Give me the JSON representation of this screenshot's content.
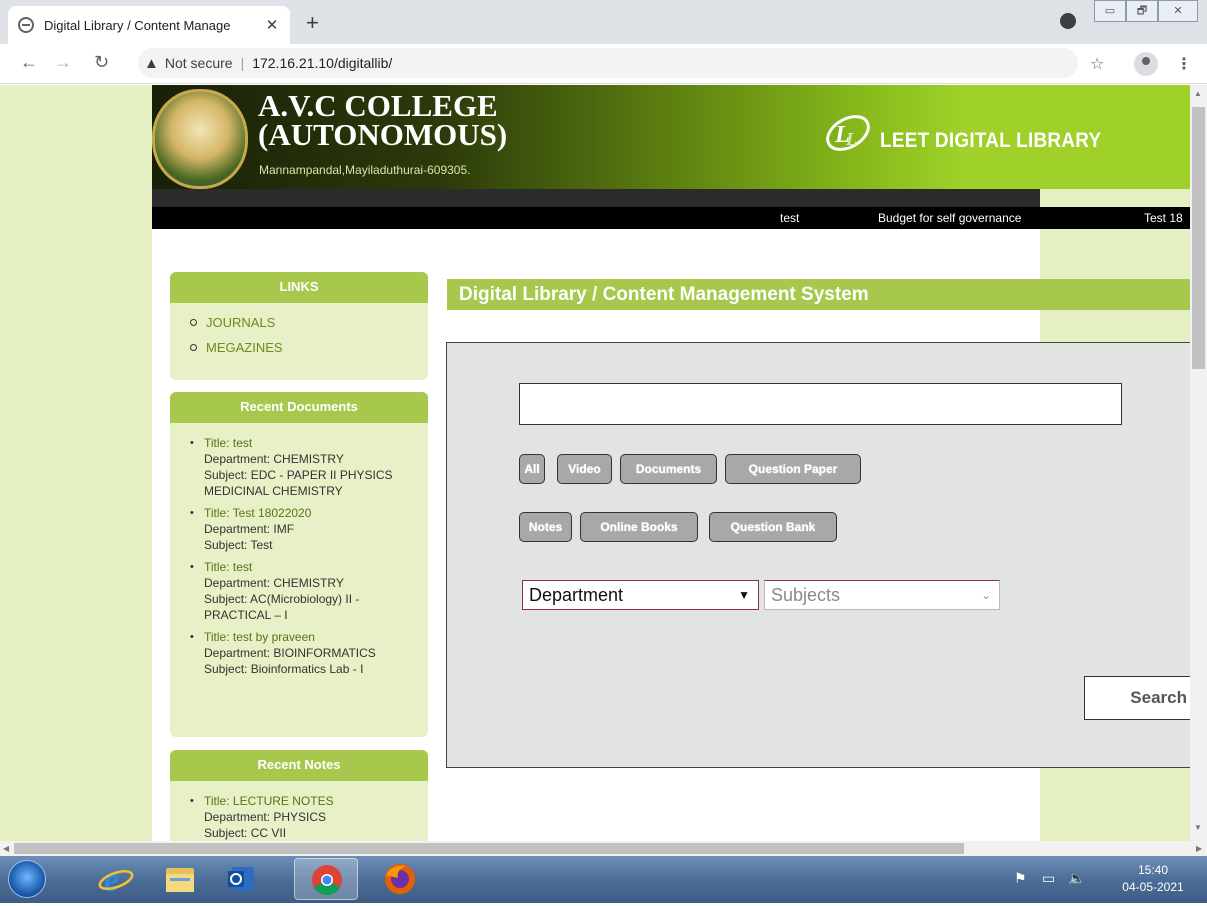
{
  "browser": {
    "tab_title": "Digital Library / Content Manage",
    "tab_close": "✕",
    "new_tab": "+",
    "not_secure": "Not secure",
    "url": "172.16.21.10/digitallib/",
    "window_min": "▭",
    "window_max": "🗗",
    "window_close": "✕"
  },
  "header": {
    "college_line1": "A.V.C COLLEGE",
    "college_line2": "(AUTONOMOUS)",
    "address": "Mannampandal,Mayiladuthurai-609305.",
    "library_name": "LEET DIGITAL LIBRARY",
    "ticker": [
      "test",
      "Budget for self governance",
      "Test 18"
    ]
  },
  "sidebar": {
    "links": {
      "heading": "LINKS",
      "items": [
        "JOURNALS",
        "MEGAZINES"
      ]
    },
    "recent_documents": {
      "heading": "Recent Documents",
      "items": [
        {
          "title": "Title: test",
          "department": "Department: CHEMISTRY",
          "subject": "Subject: EDC - PAPER II PHYSICS MEDICINAL CHEMISTRY"
        },
        {
          "title": "Title: Test 18022020",
          "department": "Department: IMF",
          "subject": "Subject: Test"
        },
        {
          "title": "Title: test",
          "department": "Department: CHEMISTRY",
          "subject": "Subject: AC(Microbiology) II - PRACTICAL – I"
        },
        {
          "title": "Title: test by praveen",
          "department": "Department: BIOINFORMATICS",
          "subject": "Subject: Bioinformatics Lab - I"
        }
      ]
    },
    "recent_notes": {
      "heading": "Recent Notes",
      "items": [
        {
          "title": "Title: LECTURE NOTES",
          "department": "Department: PHYSICS",
          "subject": "Subject: CC VII"
        }
      ]
    }
  },
  "main": {
    "heading": "Digital Library / Content Management System",
    "search_value": "",
    "filters_row1": [
      "All",
      "Video",
      "Documents",
      "Question Paper"
    ],
    "filters_row2": [
      "Notes",
      "Online Books",
      "Question Bank"
    ],
    "department_select": "Department",
    "subjects_select": "Subjects",
    "search_button": "Search"
  },
  "taskbar": {
    "time": "15:40",
    "date": "04-05-2021"
  },
  "colors": {
    "accent_green": "#a7c84d",
    "page_bg": "#e4efc2",
    "panel_grey": "#e1e4e1"
  }
}
